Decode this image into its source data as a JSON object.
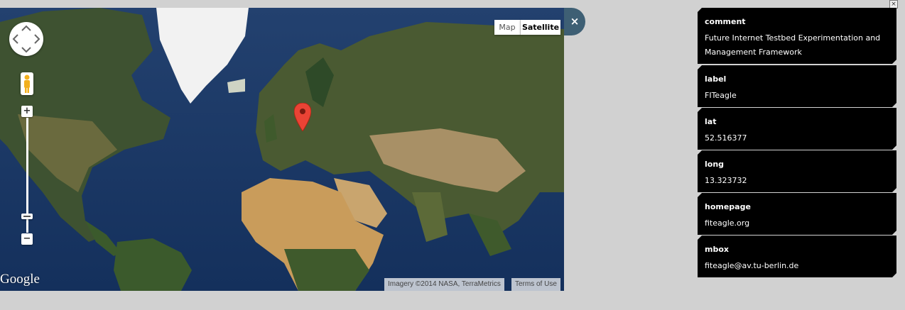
{
  "map": {
    "type_buttons": {
      "map": "Map",
      "satellite": "Satellite"
    },
    "zoom_in": "+",
    "zoom_out": "−",
    "logo": "Google",
    "imagery_credit": "Imagery ©2014 NASA, TerraMetrics",
    "terms": "Terms of Use",
    "close": "×"
  },
  "panel": {
    "close": "×",
    "fields": [
      {
        "key": "comment",
        "value": "Future Internet Testbed Experimentation and Management Framework"
      },
      {
        "key": "label",
        "value": "FITeagle"
      },
      {
        "key": "lat",
        "value": "52.516377"
      },
      {
        "key": "long",
        "value": "13.323732"
      },
      {
        "key": "homepage",
        "value": "fiteagle.org"
      },
      {
        "key": "mbox",
        "value": "fiteagle@av.tu-berlin.de"
      }
    ]
  }
}
